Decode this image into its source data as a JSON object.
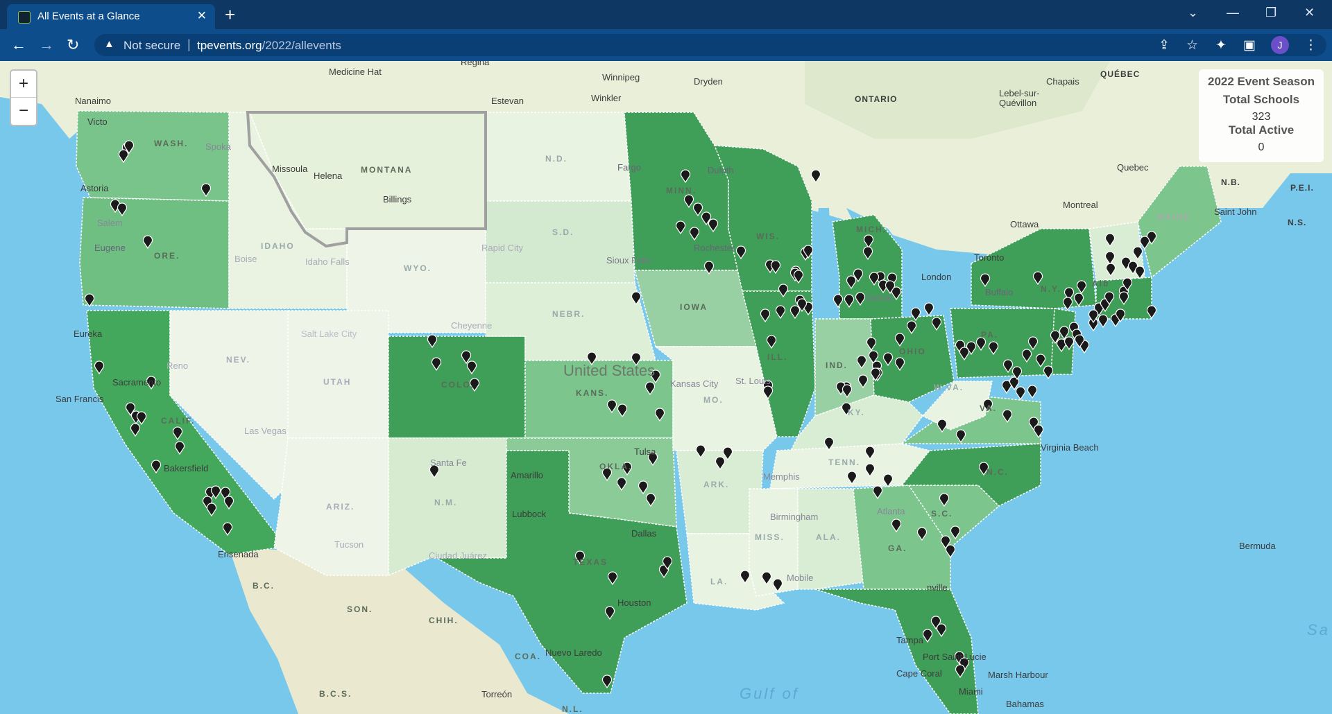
{
  "browser": {
    "tab_title": "All Events at a Glance",
    "security_label": "Not secure",
    "url_host": "tpevents.org",
    "url_path": "/2022/allevents",
    "profile_initial": "J"
  },
  "map": {
    "zoom_in_label": "+",
    "zoom_out_label": "−",
    "info": {
      "season_title": "2022 Event Season",
      "total_schools_label": "Total Schools",
      "total_schools_value": "323",
      "total_active_label": "Total Active",
      "total_active_value": "0"
    },
    "labels": {
      "medicine_hat": "Medicine Hat",
      "regina": "Regina",
      "winnipeg": "Winnipeg",
      "dryden": "Dryden",
      "chapais": "Chapais",
      "quebec_prov": "QUÉBEC",
      "ontario": "ONTARIO",
      "lebel": "Lebel-sur-Quévillon",
      "nanaimo": "Nanaimo",
      "victoria": "Victo",
      "estevan": "Estevan",
      "winkler": "Winkler",
      "quebec_city": "Quebec",
      "nb": "N.B.",
      "pei": "P.E.I.",
      "montreal": "Montreal",
      "saint_john": "Saint John",
      "ns": "N.S.",
      "ottawa": "Ottawa",
      "toronto": "Toronto",
      "london": "London",
      "wash": "WASH.",
      "spokane": "Spoka",
      "missoula": "Missoula",
      "helena": "Helena",
      "montana": "MONTANA",
      "nd": "N.D.",
      "fargo": "Fargo",
      "duluth": "Duluth",
      "billings": "Billings",
      "astoria": "Astoria",
      "minn": "MINN.",
      "salem": "Salem",
      "eugene": "Eugene",
      "ore": "ORE.",
      "idaho": "IDAHO",
      "boise": "Boise",
      "idaho_falls": "Idaho Falls",
      "sd": "S.D.",
      "rapid_city": "Rapid City",
      "sioux_falls": "Sioux Falls",
      "wyo": "WYO.",
      "wis": "WIS.",
      "rochester": "Rochester",
      "mich": "MICH.",
      "maine": "MAINE",
      "eureka": "Eureka",
      "nebr": "NEBR.",
      "cheyenne": "Cheyenne",
      "salt_lake": "Salt Lake City",
      "iowa": "IOWA",
      "detroit": "Detroit",
      "buffalo": "Buffalo",
      "ny": "N.Y.",
      "albany": "Alb",
      "nev": "NEV.",
      "reno": "Reno",
      "utah": "UTAH",
      "colo": "COLO.",
      "united_states": "United States",
      "ill": "ILL.",
      "ind": "IND.",
      "ohio": "OHIO",
      "pa": "PA.",
      "sacramento": "Sacramento",
      "san_francisco": "San Francis",
      "kansas_city": "Kansas City",
      "st_louis": "St. Louis",
      "mo": "MO.",
      "kans": "KANS.",
      "wva": "W.VA.",
      "va": "VA.",
      "calif": "CALIF.",
      "ky": "KY.",
      "las_vegas": "Las Vegas",
      "bakersfield": "Bakersfield",
      "tulsa": "Tulsa",
      "okla": "OKLA.",
      "tenn": "TENN.",
      "virginia_beach": "Virginia Beach",
      "nc": "N.C.",
      "santa_fe": "Santa Fe",
      "amarillo": "Amarillo",
      "ark": "ARK.",
      "memphis": "Memphis",
      "ariz": "ARIZ.",
      "nm": "N.M.",
      "sc": "S.C.",
      "lubbock": "Lubbock",
      "dallas": "Dallas",
      "birmingham": "Birmingham",
      "atlanta": "Atlanta",
      "tucson": "Tucson",
      "bermuda": "Bermuda",
      "ensenada": "Ensenada",
      "ciudad_juarez": "Ciudad Juárez",
      "miss": "MISS.",
      "ala": "ALA.",
      "ga": "GA.",
      "texas": "TEXAS",
      "bc_mex": "B.C.",
      "la": "LA.",
      "mobile": "Mobile",
      "jacksonville": "nville",
      "houston": "Houston",
      "son": "SON.",
      "chih": "CHIH.",
      "tampa": "Tampa",
      "port_st_lucie": "Port Saint Lucie",
      "marsh_harbour": "Marsh Harbour",
      "coa": "COA.",
      "nuevo_laredo": "Nuevo Laredo",
      "cape_coral": "Cape Coral",
      "miami": "Miami",
      "sa": "Sa",
      "gulf": "Gulf of",
      "bcs": "B.C.S.",
      "torreon": "Torreón",
      "nl": "N.L.",
      "bahamas": "Bahamas"
    }
  }
}
